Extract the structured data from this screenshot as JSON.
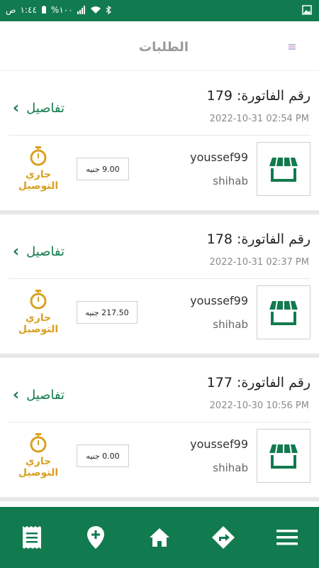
{
  "status_bar": {
    "time": "١:٤٤",
    "ampm": "ص",
    "battery": "%١٠٠"
  },
  "header": {
    "title": "الطلبات"
  },
  "orders": [
    {
      "invoice": "رقم الفاتورة: 179",
      "date": "2022-10-31 02:54 PM",
      "details_label": "تفاصيل",
      "customer": "youssef99",
      "store": "shihab",
      "price": "9.00 جنيه",
      "status": "جاري التوصيل"
    },
    {
      "invoice": "رقم الفاتورة: 178",
      "date": "2022-10-31 02:37 PM",
      "details_label": "تفاصيل",
      "customer": "youssef99",
      "store": "shihab",
      "price": "217.50 جنيه",
      "status": "جاري التوصيل"
    },
    {
      "invoice": "رقم الفاتورة: 177",
      "date": "2022-10-30 10:56 PM",
      "details_label": "تفاصيل",
      "customer": "youssef99",
      "store": "shihab",
      "price": "0.00 جنيه",
      "status": "جاري التوصيل"
    }
  ],
  "nav": {
    "items": [
      "receipt-icon",
      "add-location-icon",
      "home-icon",
      "directions-icon",
      "menu-icon"
    ]
  },
  "colors": {
    "primary": "#127a4f",
    "status": "#d9a022",
    "muted": "#8c8c8c"
  }
}
